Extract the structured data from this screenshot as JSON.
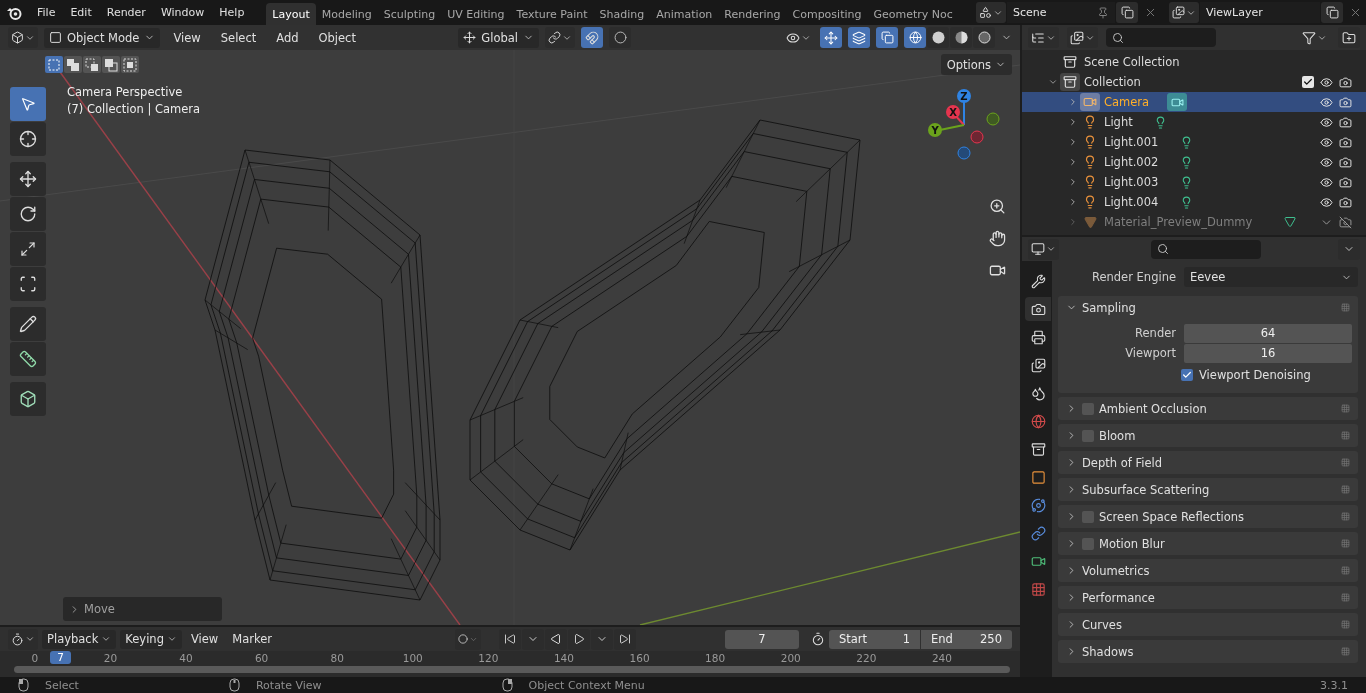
{
  "top_bar": {
    "menus": [
      "File",
      "Edit",
      "Render",
      "Window",
      "Help"
    ],
    "workspaces": [
      {
        "label": "Layout",
        "selected": true
      },
      {
        "label": "Modeling",
        "selected": false
      },
      {
        "label": "Sculpting",
        "selected": false
      },
      {
        "label": "UV Editing",
        "selected": false
      },
      {
        "label": "Texture Paint",
        "selected": false
      },
      {
        "label": "Shading",
        "selected": false
      },
      {
        "label": "Animation",
        "selected": false
      },
      {
        "label": "Rendering",
        "selected": false
      },
      {
        "label": "Compositing",
        "selected": false
      },
      {
        "label": "Geometry Noc",
        "selected": false
      }
    ],
    "scene": "Scene",
    "view_layer": "ViewLayer"
  },
  "viewport": {
    "header": {
      "mode": "Object Mode",
      "menus": [
        "View",
        "Select",
        "Add",
        "Object"
      ],
      "orientation": "Global",
      "toggles": [
        {
          "kind": "snap",
          "on": true
        },
        {
          "kind": "proportional",
          "on": false
        },
        {
          "kind": "gizmos",
          "on": true
        },
        {
          "kind": "overlays",
          "on": true
        },
        {
          "kind": "xray",
          "on": true
        }
      ],
      "shading_modes": [
        {
          "kind": "wireframe",
          "selected": true
        },
        {
          "kind": "solid",
          "selected": false
        },
        {
          "kind": "material",
          "selected": false
        },
        {
          "kind": "rendered",
          "selected": false
        }
      ]
    },
    "select_modes": [
      {
        "kind": "set",
        "selected": true
      },
      {
        "kind": "extend",
        "selected": false
      },
      {
        "kind": "subtract",
        "selected": false
      },
      {
        "kind": "invert",
        "selected": false
      },
      {
        "kind": "intersect",
        "selected": false
      }
    ],
    "options_button": "Options",
    "info": [
      "Camera Perspective",
      "(7) Collection | Camera"
    ],
    "tool_groups": [
      [
        {
          "kind": "select_box",
          "selected": true
        },
        {
          "kind": "cursor",
          "selected": false
        }
      ],
      [
        {
          "kind": "move",
          "selected": false
        },
        {
          "kind": "rotate",
          "selected": false
        },
        {
          "kind": "scale",
          "selected": false
        },
        {
          "kind": "transform",
          "selected": false
        }
      ],
      [
        {
          "kind": "annotate",
          "selected": false
        },
        {
          "kind": "measure",
          "selected": false
        }
      ],
      [
        {
          "kind": "add_cube",
          "selected": false
        }
      ]
    ],
    "gizmo": [
      {
        "label": "Z",
        "color": "#2f83e3"
      },
      {
        "label": "X",
        "color": "#e5344e"
      },
      {
        "label": "Y",
        "color": "#6ba31c"
      }
    ],
    "last_operator": "Move"
  },
  "outliner": {
    "root": "Scene Collection",
    "collection": {
      "name": "Collection",
      "expanded": true,
      "checked": true,
      "children": [
        {
          "name": "Camera",
          "kind": "camera",
          "selected": true,
          "disabled": false
        },
        {
          "name": "Light",
          "kind": "light",
          "selected": false,
          "disabled": false
        },
        {
          "name": "Light.001",
          "kind": "light",
          "selected": false,
          "disabled": false
        },
        {
          "name": "Light.002",
          "kind": "light",
          "selected": false,
          "disabled": false
        },
        {
          "name": "Light.003",
          "kind": "light",
          "selected": false,
          "disabled": false
        },
        {
          "name": "Light.004",
          "kind": "light",
          "selected": false,
          "disabled": false
        },
        {
          "name": "Material_Preview_Dummy",
          "kind": "mesh",
          "selected": false,
          "disabled": true
        }
      ]
    }
  },
  "properties": {
    "tabs": [
      {
        "kind": "tool",
        "selected": false
      },
      {
        "kind": "render",
        "selected": true
      },
      {
        "kind": "output",
        "selected": false
      },
      {
        "kind": "view_layer",
        "selected": false
      },
      {
        "kind": "scene",
        "selected": false
      },
      {
        "kind": "world",
        "selected": false
      },
      {
        "kind": "collection",
        "selected": false
      },
      {
        "kind": "object",
        "selected": false
      },
      {
        "kind": "physics",
        "selected": false
      },
      {
        "kind": "constraints",
        "selected": false
      },
      {
        "kind": "data",
        "selected": false
      },
      {
        "kind": "texture",
        "selected": false
      }
    ],
    "render_engine_label": "Render Engine",
    "render_engine": "Eevee",
    "panels": [
      {
        "title": "Sampling",
        "kind": "plain",
        "expanded": true,
        "fields": [
          {
            "label": "Render",
            "value": "64"
          },
          {
            "label": "Viewport",
            "value": "16"
          }
        ],
        "option": {
          "label": "Viewport Denoising",
          "checked": true
        }
      },
      {
        "title": "Ambient Occlusion",
        "kind": "toggle",
        "checked": false,
        "expanded": false
      },
      {
        "title": "Bloom",
        "kind": "toggle",
        "checked": false,
        "expanded": false
      },
      {
        "title": "Depth of Field",
        "kind": "plain",
        "expanded": false
      },
      {
        "title": "Subsurface Scattering",
        "kind": "plain",
        "expanded": false
      },
      {
        "title": "Screen Space Reflections",
        "kind": "toggle",
        "checked": false,
        "expanded": false
      },
      {
        "title": "Motion Blur",
        "kind": "toggle",
        "checked": false,
        "expanded": false
      },
      {
        "title": "Volumetrics",
        "kind": "plain",
        "expanded": false
      },
      {
        "title": "Performance",
        "kind": "plain",
        "expanded": false
      },
      {
        "title": "Curves",
        "kind": "plain",
        "expanded": false
      },
      {
        "title": "Shadows",
        "kind": "plain",
        "expanded": false
      }
    ]
  },
  "timeline": {
    "menus": [
      {
        "label": "Playback",
        "dropdown": true
      },
      {
        "label": "Keying",
        "dropdown": true
      },
      {
        "label": "View",
        "dropdown": false
      },
      {
        "label": "Marker",
        "dropdown": false
      }
    ],
    "current_frame": "7",
    "start_label": "Start",
    "start": "1",
    "end_label": "End",
    "end": "250",
    "ruler": [
      "0",
      "20",
      "40",
      "60",
      "80",
      "100",
      "120",
      "140",
      "160",
      "180",
      "200",
      "220",
      "240"
    ],
    "playhead": "7"
  },
  "status_bar": {
    "hints": [
      {
        "kind": "left_click",
        "label": "Select"
      },
      {
        "kind": "middle_click",
        "label": "Rotate View"
      },
      {
        "kind": "right_click",
        "label": "Object Context Menu"
      }
    ],
    "version": "3.3.1"
  }
}
